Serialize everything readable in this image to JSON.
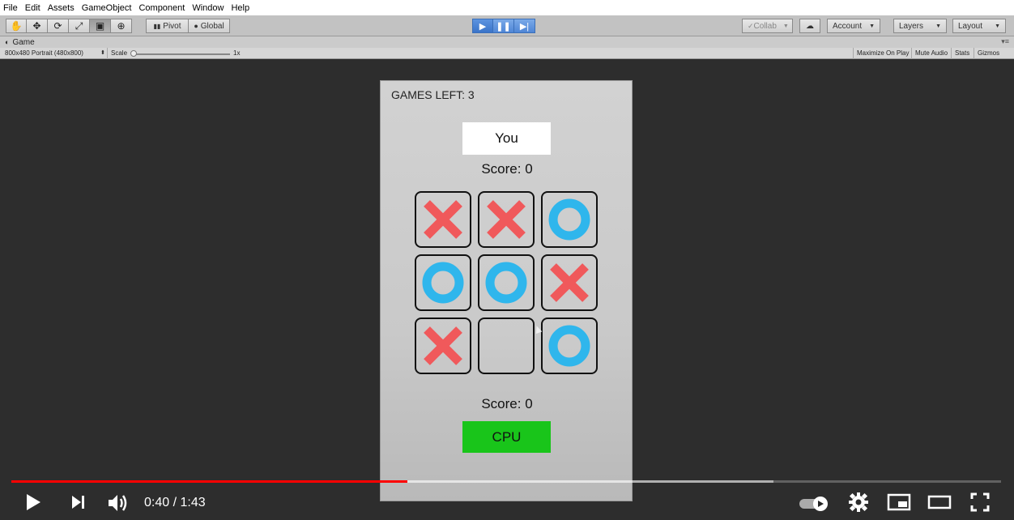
{
  "menubar": {
    "items": [
      "File",
      "Edit",
      "Assets",
      "GameObject",
      "Component",
      "Window",
      "Help"
    ]
  },
  "toolbar": {
    "pivot_label": "Pivot",
    "global_label": "Global",
    "collab_label": "Collab",
    "account_label": "Account",
    "layers_label": "Layers",
    "layout_label": "Layout"
  },
  "game_tab": {
    "title": "Game",
    "resolution": "800x480 Portrait (480x800)",
    "scale_label": "Scale",
    "scale_value": "1x",
    "maximize_on_play": "Maximize On Play",
    "mute_audio": "Mute Audio",
    "stats": "Stats",
    "gizmos": "Gizmos"
  },
  "game": {
    "games_left": "GAMES LEFT: 3",
    "player_name": "You",
    "player_score": "Score: 0",
    "cpu_score": "Score: 0",
    "cpu_name": "CPU",
    "board": [
      "X",
      "X",
      "O",
      "O",
      "O",
      "X",
      "X",
      "",
      "O"
    ],
    "colors": {
      "x": "#f0595b",
      "o": "#2fb6ec",
      "cpu": "#19c51a"
    }
  },
  "player": {
    "time": "0:40 / 1:43",
    "progress": 0.4,
    "buffered": 0.77,
    "icons": [
      "play-icon",
      "next-icon",
      "volume-icon",
      "autoplay-toggle-icon",
      "settings-icon",
      "miniplayer-icon",
      "theater-icon",
      "fullscreen-icon"
    ]
  }
}
